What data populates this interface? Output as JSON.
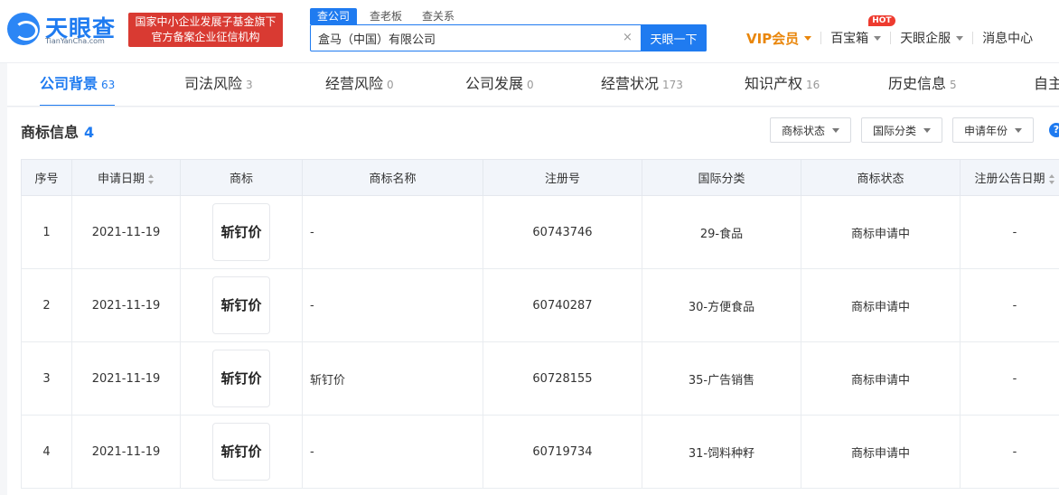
{
  "header": {
    "logo_name": "天眼查",
    "logo_url": "TianYanCha.com",
    "gov_badge_line1": "国家中小企业发展子基金旗下",
    "gov_badge_line2": "官方备案企业征信机构",
    "search_tabs": [
      "查公司",
      "查老板",
      "查关系"
    ],
    "search_value": "盒马（中国）有限公司",
    "clear_icon": "×",
    "search_button": "天眼一下",
    "nav": {
      "vip": "VIP会员",
      "treasure": "百宝箱",
      "hot_badge": "HOT",
      "enterprise": "天眼企服",
      "messages": "消息中心"
    }
  },
  "tabs": [
    {
      "label": "公司背景",
      "count": "63"
    },
    {
      "label": "司法风险",
      "count": "3"
    },
    {
      "label": "经营风险",
      "count": "0"
    },
    {
      "label": "公司发展",
      "count": "0"
    },
    {
      "label": "经营状况",
      "count": "173"
    },
    {
      "label": "知识产权",
      "count": "16"
    },
    {
      "label": "历史信息",
      "count": "5"
    },
    {
      "label": "自主",
      "count": ""
    }
  ],
  "section": {
    "title": "商标信息",
    "count": "4",
    "filters": [
      "商标状态",
      "国际分类",
      "申请年份"
    ]
  },
  "table": {
    "headers": [
      "序号",
      "申请日期",
      "商标",
      "商标名称",
      "注册号",
      "国际分类",
      "商标状态",
      "注册公告日期"
    ],
    "rows": [
      {
        "no": "1",
        "date": "2021-11-19",
        "logo_text": "斩钉价",
        "name": "-",
        "reg_no": "60743746",
        "class": "29-食品",
        "status": "商标申请中",
        "announce": "-"
      },
      {
        "no": "2",
        "date": "2021-11-19",
        "logo_text": "斩钉价",
        "name": "-",
        "reg_no": "60740287",
        "class": "30-方便食品",
        "status": "商标申请中",
        "announce": "-"
      },
      {
        "no": "3",
        "date": "2021-11-19",
        "logo_text": "斩钉价",
        "name": "斩钉价",
        "reg_no": "60728155",
        "class": "35-广告销售",
        "status": "商标申请中",
        "announce": "-"
      },
      {
        "no": "4",
        "date": "2021-11-19",
        "logo_text": "斩钉价",
        "name": "-",
        "reg_no": "60719734",
        "class": "31-饲料种籽",
        "status": "商标申请中",
        "announce": "-"
      }
    ]
  },
  "colors": {
    "brand_blue": "#1f7bf0",
    "vip_orange": "#e9860b",
    "badge_red": "#d93a32",
    "hot_red": "#ee3b2f"
  },
  "icons": [
    "logo-icon",
    "clear-icon",
    "chevron-down-icon",
    "sort-icon",
    "help-icon"
  ]
}
